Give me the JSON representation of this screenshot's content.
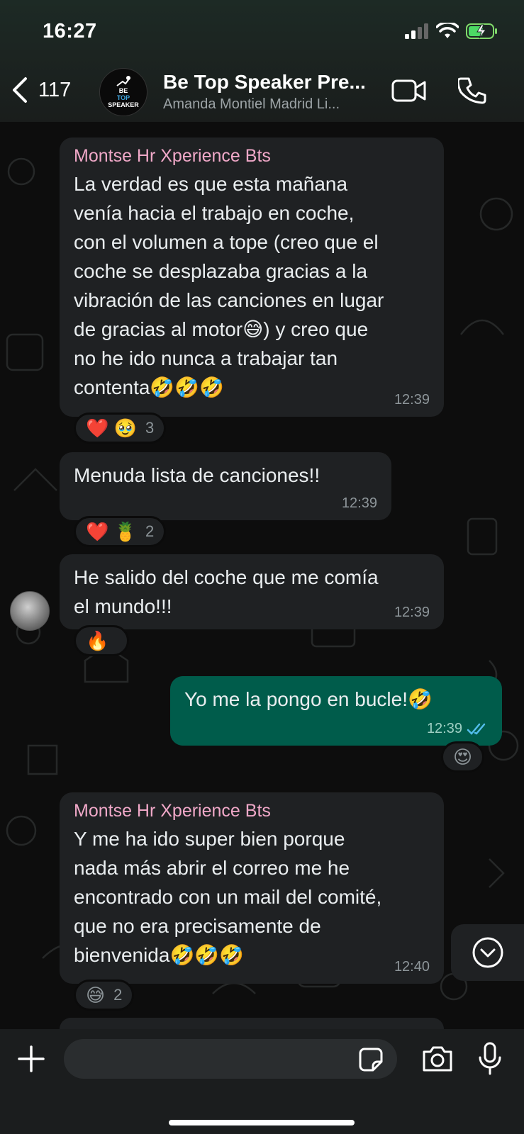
{
  "status_bar": {
    "time": "16:27"
  },
  "header": {
    "back_count": "117",
    "avatar_text": [
      "BE",
      "TOP",
      "SPEAKER"
    ],
    "title": "Be Top Speaker Pre...",
    "subtitle": "Amanda Montiel Madrid Li..."
  },
  "messages": [
    {
      "sender": "Montse Hr Xperience  Bts",
      "text": "La verdad es que esta mañana\nvenía hacia el trabajo en coche,\ncon el volumen a tope (creo que el\ncoche se desplazaba gracias a la\nvibración de las canciones en lugar\nde gracias al motor😅) y creo que\nno he ido nunca a trabajar tan\ncontenta🤣🤣🤣",
      "time": "12:39",
      "reactions": {
        "emojis": "❤️ 🥹",
        "count": "3"
      }
    },
    {
      "text": "Menuda lista de canciones!!",
      "time": "12:39",
      "reactions": {
        "emojis": "❤️ 🍍",
        "count": "2"
      }
    },
    {
      "text": "He salido del coche que me comía\nel mundo!!!",
      "time": "12:39",
      "reactions": {
        "emojis": "🔥",
        "count": ""
      }
    },
    {
      "text": "Yo me la pongo en bucle!🤣",
      "time": "12:39",
      "reactions": {
        "emojis": "😍",
        "count": ""
      }
    },
    {
      "sender": "Montse Hr Xperience  Bts",
      "text": "Y me ha ido super bien porque\nnada más abrir el correo me he\nencontrado con un mail del comité,\nque no era precisamente de\nbienvenida🤣🤣🤣",
      "time": "12:40",
      "reactions": {
        "emojis": "😅",
        "count": "2"
      }
    }
  ],
  "input": {
    "placeholder": ""
  },
  "icons": {
    "back": "chevron-left-icon",
    "video": "video-camera-icon",
    "call": "phone-icon",
    "plus": "plus-icon",
    "sticker": "sticker-icon",
    "camera": "camera-icon",
    "mic": "microphone-icon",
    "scroll": "chevron-down-circle-icon"
  },
  "colors": {
    "incoming_bubble": "#1f2123",
    "outgoing_bubble": "#005c4b",
    "sender_name": "#f0a8c8",
    "read_ticks": "#53bdeb"
  }
}
